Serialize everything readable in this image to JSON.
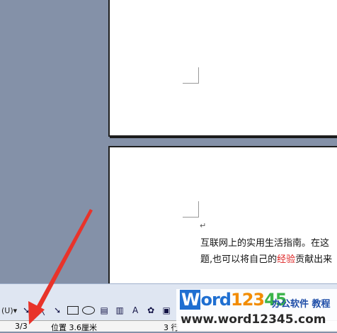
{
  "document": {
    "line1": "互联网上的实用生活指南。在这",
    "line2_before": "题,也可以将自己的",
    "line2_highlight": "经验",
    "line2_after": "贡献出来"
  },
  "toolbar": {
    "draw_label": "(U)▾"
  },
  "statusbar": {
    "page": "3/3",
    "position": "位置 3.6厘米",
    "line": "3 行"
  },
  "watermark": {
    "logo_word": "W",
    "logo_ord": "ord",
    "logo_n1": "123",
    "logo_n2": "45",
    "tagline": "办公软件 教程",
    "url": "www.word12345.com"
  },
  "colors": {
    "workspace": "#8491a8",
    "annotation_arrow": "#e8332a",
    "highlight_text": "#d22222"
  }
}
